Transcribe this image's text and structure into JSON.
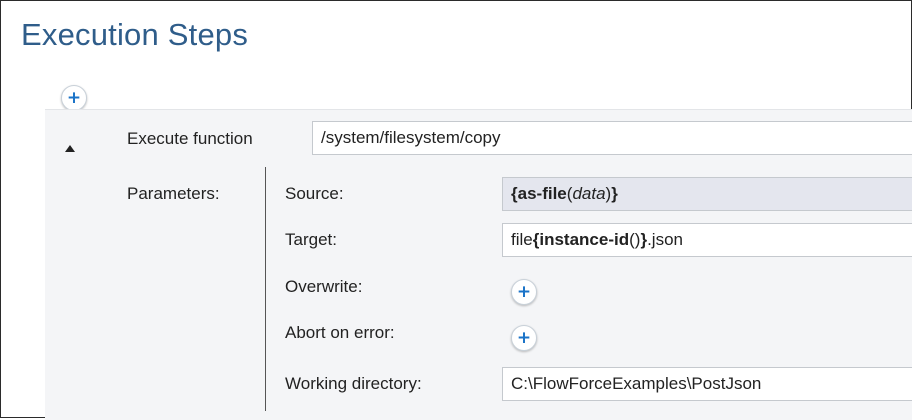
{
  "page": {
    "title": "Execution Steps"
  },
  "step": {
    "execute_label": "Execute function",
    "function_path": "/system/filesystem/copy",
    "parameters_label": "Parameters:",
    "params": {
      "source": {
        "label": "Source:",
        "open": "{",
        "func": "as-file",
        "paren_open": "(",
        "arg": "data",
        "paren_close": ")",
        "close": "}"
      },
      "target": {
        "label": "Target:",
        "prefix": "file",
        "open": "{",
        "func": "instance-id",
        "call": "()",
        "close": "}",
        "suffix": ".json"
      },
      "overwrite": {
        "label": "Overwrite:"
      },
      "abort_on_error": {
        "label": "Abort on error:"
      },
      "working_directory": {
        "label": "Working directory:",
        "value": "C:\\FlowForceExamples\\PostJson"
      }
    }
  },
  "icons": {
    "add": "plus-icon",
    "collapse": "collapse-triangle-icon"
  },
  "colors": {
    "title": "#2f5d8a",
    "add_icon": "#1a73c8",
    "panel_bg": "#f4f5f7",
    "expression_highlight": "#e4e6ee"
  }
}
